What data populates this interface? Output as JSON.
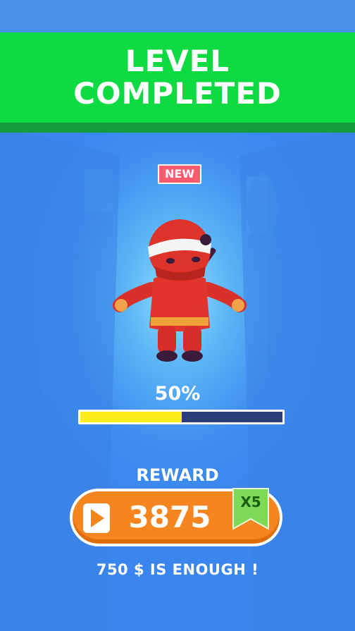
{
  "banner": {
    "title_line1": "LEVEL",
    "title_line2": "COMPLETED"
  },
  "badge": {
    "label": "NEW"
  },
  "progress": {
    "label": "50%",
    "fraction": 0.5
  },
  "reward": {
    "label": "REWARD",
    "amount": "3875",
    "multiplier": "X5",
    "play_icon": "play-icon"
  },
  "footer": {
    "text": "750 $ IS ENOUGH !"
  },
  "colors": {
    "banner_green": "#0edb42",
    "badge_red": "#ff5a6e",
    "progress_fill": "#ffee1a",
    "progress_track": "#2c3e78",
    "reward_orange": "#f5861f",
    "multiplier_green": "#7ed957",
    "background_blue": "#3f8ff0"
  }
}
